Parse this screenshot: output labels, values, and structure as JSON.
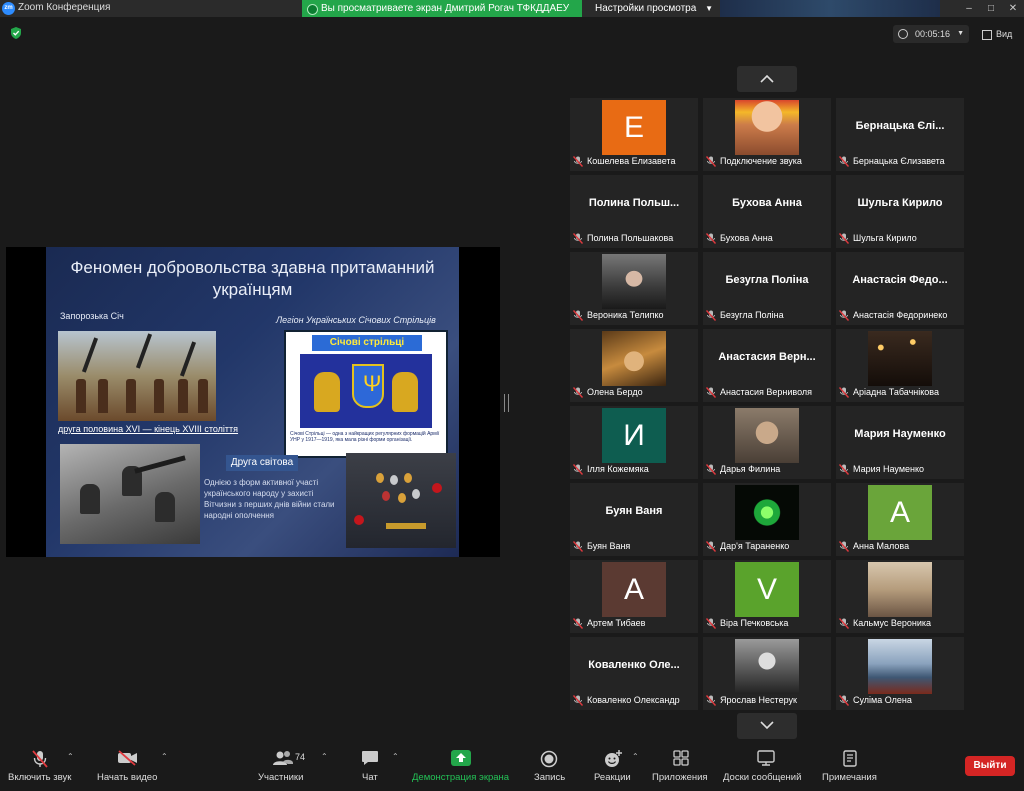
{
  "window": {
    "app_title": "Zoom Конференция",
    "logo_text": "zm",
    "share_banner": "Вы просматриваете экран Дмитрий Рогач ТФКДДАЕУ",
    "view_options": "Настройки просмотра",
    "controls": [
      "–",
      "□",
      "✕"
    ]
  },
  "meeting": {
    "timer": "00:05:16",
    "view_label": "Вид"
  },
  "slide": {
    "title": "Феномен добровольства здавна притаманний українцям",
    "left_caption": "Запорозька Січ",
    "right_caption": "Легіон Українських Січових Стрільців",
    "period_caption": "друга половина XVI — кінець XVIII століття",
    "sich_header": "Січові стрільці",
    "sich_fine": "Січові Стрільці — одна з найкращих регулярних формацій Армії УНР у 1917—1919, яка мала різні форми організації.",
    "ww2_label": "Друга світова",
    "ww2_text": "Однією з форм активної участі українського народу у захисті Вітчизни з перших днів війни стали народні ополчення"
  },
  "participants": [
    {
      "name": "Кошелева Елизавета",
      "letter": "E",
      "color": "#e86b14",
      "type": "letter"
    },
    {
      "name": "Подключение звука",
      "type": "photo",
      "photo": "wreath"
    },
    {
      "name": "Бернацька Єлизавета",
      "big": "Бернацька Єлі...",
      "type": "text"
    },
    {
      "name": "Полина Польшакова",
      "big": "Полина Польш...",
      "type": "text"
    },
    {
      "name": "Бухова Анна",
      "big": "Бухова Анна",
      "type": "text"
    },
    {
      "name": "Шульга Кирило",
      "big": "Шульга Кирило",
      "type": "text"
    },
    {
      "name": "Вероника Телипко",
      "type": "photo",
      "photo": "girl-dark"
    },
    {
      "name": "Безугла Поліна",
      "big": "Безугла Поліна",
      "type": "text"
    },
    {
      "name": "Анастасія Федоринеко",
      "big": "Анастасія Федо...",
      "type": "text"
    },
    {
      "name": "Олена Бердо",
      "type": "photo",
      "photo": "gold"
    },
    {
      "name": "Анастасия Верниволя",
      "big": "Анастасия Верн...",
      "type": "text"
    },
    {
      "name": "Аріадна Табачнікова",
      "type": "photo",
      "photo": "lights"
    },
    {
      "name": "Ілля Кожемяка",
      "letter": "И",
      "color": "#0e5d50",
      "type": "letter"
    },
    {
      "name": "Дарья Филина",
      "type": "photo",
      "photo": "monkey"
    },
    {
      "name": "Мария Науменко",
      "big": "Мария Науменко",
      "type": "text"
    },
    {
      "name": "Буян Ваня",
      "big": "Буян Ваня",
      "type": "text"
    },
    {
      "name": "Дар'я Тараненко",
      "type": "photo",
      "photo": "green"
    },
    {
      "name": "Анна Малова",
      "letter": "A",
      "color": "#6aa53a",
      "type": "letter"
    },
    {
      "name": "Артем Тибаев",
      "letter": "A",
      "color": "#5b3a32",
      "type": "letter"
    },
    {
      "name": "Віра Печковська",
      "letter": "V",
      "color": "#5aa32c",
      "type": "letter"
    },
    {
      "name": "Кальмус Вероника",
      "type": "photo",
      "photo": "room"
    },
    {
      "name": "Коваленко Олександр",
      "big": "Коваленко Оле...",
      "type": "text"
    },
    {
      "name": "Ярослав Нестерук",
      "type": "photo",
      "photo": "bw"
    },
    {
      "name": "Суліма Олена",
      "type": "photo",
      "photo": "sea"
    }
  ],
  "toolbar": {
    "mute": "Включить звук",
    "video": "Начать видео",
    "participants": "Участники",
    "participants_count": "74",
    "chat": "Чат",
    "share": "Демонстрация экрана",
    "record": "Запись",
    "reactions": "Реакции",
    "apps": "Приложения",
    "whiteboards": "Доски сообщений",
    "notes": "Примечания",
    "leave": "Выйти"
  }
}
